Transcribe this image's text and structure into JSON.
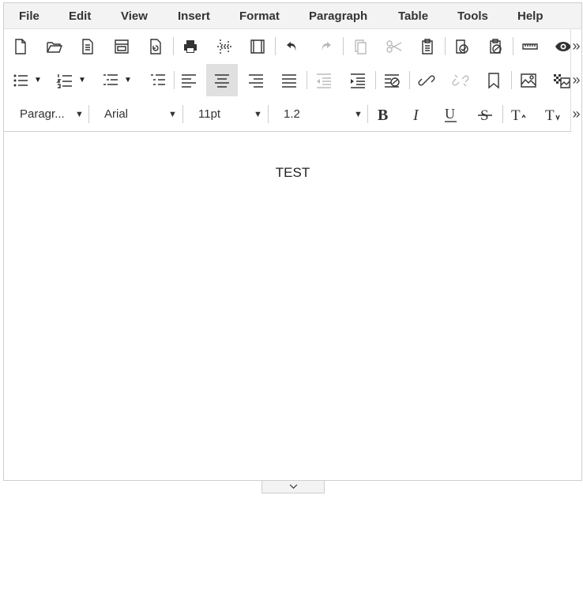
{
  "menu": [
    "File",
    "Edit",
    "View",
    "Insert",
    "Format",
    "Paragraph",
    "Table",
    "Tools",
    "Help"
  ],
  "toolbar3": {
    "block_format": "Paragr...",
    "font_family": "Arial",
    "font_size": "11pt",
    "line_height": "1.2"
  },
  "more_glyph": "»",
  "content": {
    "text": "TEST"
  },
  "status": {
    "alignment_active": "align-center"
  }
}
